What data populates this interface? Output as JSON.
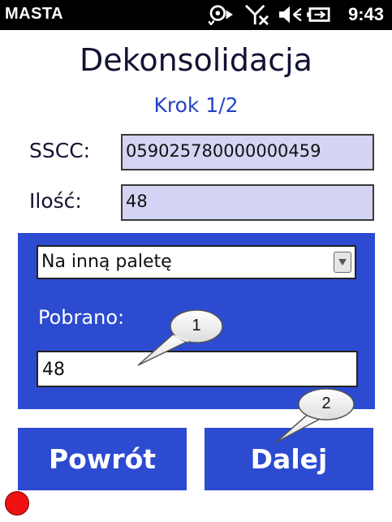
{
  "status_bar": {
    "carrier": "MASTA",
    "time": "9:43",
    "icons": [
      "sync-icon",
      "no-signal-icon",
      "speaker-muted-icon",
      "battery-charging-icon"
    ]
  },
  "header": {
    "title": "Dekonsolidacja",
    "step": "Krok 1/2"
  },
  "form": {
    "sscc_label": "SSCC:",
    "sscc_value": "059025780000000459",
    "qty_label": "Ilość:",
    "qty_value": "48"
  },
  "panel": {
    "select_value": "Na inną paletę",
    "picked_label": "Pobrano:",
    "picked_value": "48"
  },
  "buttons": {
    "back_label": "Powrót",
    "next_label": "Dalej"
  },
  "callouts": {
    "one": "1",
    "two": "2"
  },
  "colors": {
    "accent_blue": "#2c4bd0",
    "readonly_field": "#d4d4f4",
    "step_text": "#2642c8",
    "indicator_red": "#ee1111"
  }
}
